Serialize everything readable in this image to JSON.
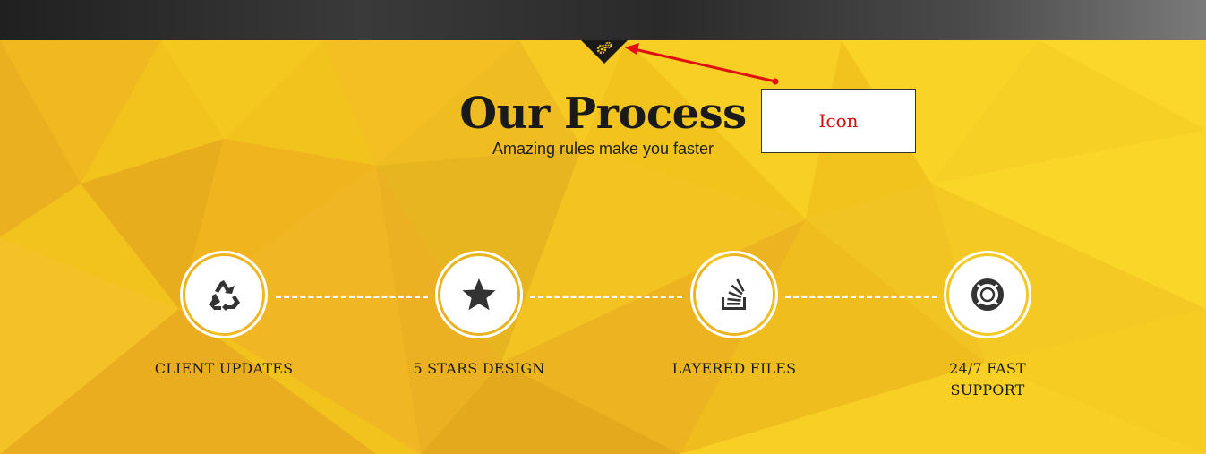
{
  "section": {
    "title": "Our Process",
    "subtitle": "Amazing rules make you faster"
  },
  "annotation": {
    "label": "Icon",
    "color": "#d11010"
  },
  "notch_icon": "gears-icon",
  "colors": {
    "background": "#f2c31d",
    "text": "#1a1a1a",
    "ring": "#ffffff",
    "notch": "#1a1a1a",
    "notch_icon": "#f2c31d"
  },
  "steps": [
    {
      "label": "CLIENT UPDATES",
      "icon": "recycle-icon"
    },
    {
      "label": "5 STARS DESIGN",
      "icon": "star-icon"
    },
    {
      "label": "LAYERED FILES",
      "icon": "stack-overflow-icon"
    },
    {
      "label": "24/7 FAST SUPPORT",
      "icon": "life-ring-icon"
    }
  ]
}
